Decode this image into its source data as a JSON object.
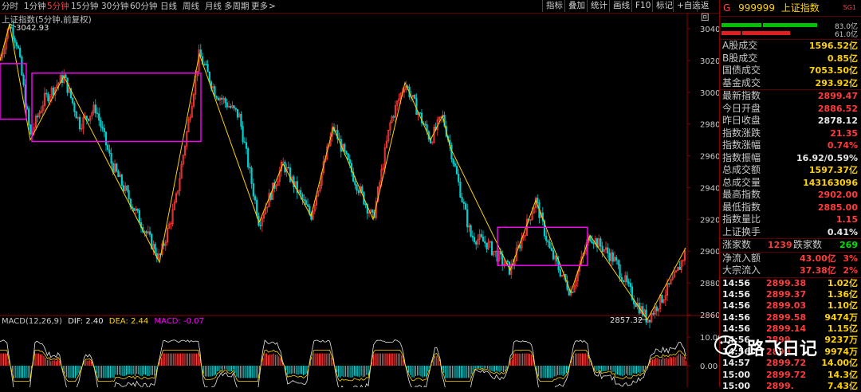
{
  "toolbar": {
    "periods": [
      "分时",
      "1分钟",
      "5分钟",
      "15分钟",
      "30分钟",
      "60分钟",
      "日线",
      "周线",
      "月线",
      "多周期",
      "更多"
    ],
    "active_period": "5分钟",
    "buttons": [
      "指标",
      "叠加",
      "统计",
      "画线",
      "F10",
      "标记",
      "+自选",
      "返回"
    ]
  },
  "chart": {
    "title": "上证指数(5分钟,前复权)",
    "high_label": "3042.93",
    "low_label": "2857.32",
    "y_ticks": [
      "3040",
      "3020",
      "3000",
      "2980",
      "2960",
      "2940",
      "2920",
      "2900",
      "2880",
      "2860"
    ],
    "macd_ticks": [
      "10.00",
      "0.00"
    ]
  },
  "macd": {
    "name": "MACD(12,26,9)",
    "dif": "DIF: 2.40",
    "dea": "DEA: 2.44",
    "macd": "MACD: -0.07"
  },
  "panel": {
    "prefix": "G",
    "code": "999999",
    "name": "上证指数",
    "badge": "SG1",
    "bar1_value": "83.0亿",
    "bar2_value": "61.0亿",
    "volume_rows": [
      {
        "label": "A股成交",
        "value": "1596.52亿"
      },
      {
        "label": "B股成交",
        "value": "0.85亿"
      },
      {
        "label": "国债成交",
        "value": "7053.50亿"
      },
      {
        "label": "基金成交",
        "value": "293.92亿"
      }
    ],
    "quote_rows": [
      {
        "label": "最新指数",
        "value": "2899.47",
        "color": "red"
      },
      {
        "label": "今日开盘",
        "value": "2886.52",
        "color": "red"
      },
      {
        "label": "昨日收盘",
        "value": "2878.12",
        "color": "white"
      },
      {
        "label": "指数涨跌",
        "value": "21.35",
        "color": "red"
      },
      {
        "label": "指数涨幅",
        "value": "0.74%",
        "color": "red"
      },
      {
        "label": "指数振幅",
        "value": "16.92/0.59%",
        "color": "white"
      },
      {
        "label": "总成交额",
        "value": "1597.37亿",
        "color": "yellow"
      },
      {
        "label": "总成交量",
        "value": "143163096",
        "color": "yellow"
      },
      {
        "label": "最高指数",
        "value": "2902.00",
        "color": "red"
      },
      {
        "label": "最低指数",
        "value": "2885.00",
        "color": "red"
      },
      {
        "label": "指数量比",
        "value": "1.15",
        "color": "red"
      },
      {
        "label": "上证换手",
        "value": "0.41%",
        "color": "white"
      }
    ],
    "breadth": {
      "up_label": "涨家数",
      "up": "1239",
      "down_label": "跌家数",
      "down": "269"
    },
    "flows": [
      {
        "label": "净流入额",
        "value": "43.00亿",
        "pct": "3%"
      },
      {
        "label": "大宗流入",
        "value": "37.38亿",
        "pct": "2%"
      }
    ],
    "ticks": [
      {
        "time": "14:56",
        "price": "2899.38",
        "vol": "1.02亿"
      },
      {
        "time": "14:56",
        "price": "2899.37",
        "vol": "1.36亿"
      },
      {
        "time": "14:56",
        "price": "2899.03",
        "vol": "1.10亿"
      },
      {
        "time": "14:56",
        "price": "2899.58",
        "vol": "9474万"
      },
      {
        "time": "14:56",
        "price": "2899.14",
        "vol": "1.15亿"
      },
      {
        "time": "14:56",
        "price": "2899.",
        "vol": "9237万"
      },
      {
        "time": "14:56",
        "price": "2899.",
        "vol": "9974万"
      },
      {
        "time": "14:57",
        "price": "2899.72",
        "vol": "14.00亿"
      },
      {
        "time": "15:00",
        "price": "2899.72",
        "vol": "14.3亿"
      },
      {
        "time": "15:00",
        "price": "2899.",
        "vol": "7.43亿"
      }
    ]
  },
  "watermark": {
    "text": "路飞日记"
  },
  "colors": {
    "up": "#ff3b3b",
    "down": "#00d0d0",
    "zigzag": "#ffd200",
    "box": "#ff00ff",
    "grid": "#8a0000"
  }
}
